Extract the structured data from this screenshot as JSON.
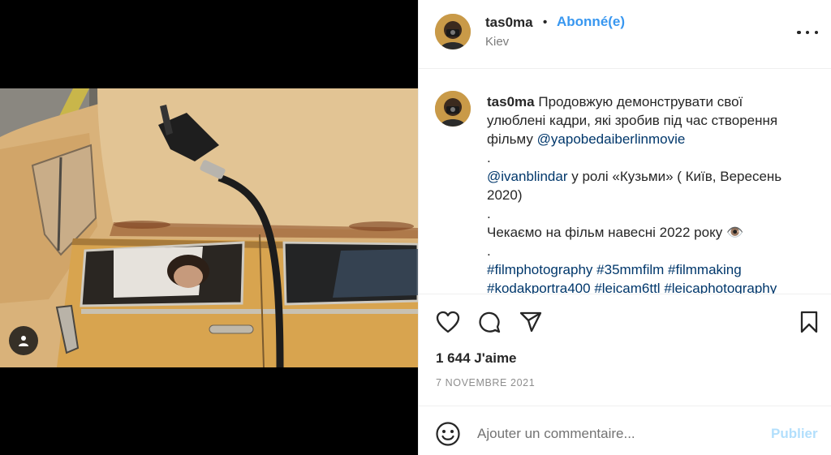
{
  "post": {
    "username": "tas0ma",
    "separator": "•",
    "follow_label": "Abonné(e)",
    "location": "Kiev"
  },
  "caption": {
    "username": "tas0ma",
    "text_1": "Продовжую демонструвати свої",
    "text_2": "улюблені кадри, які зробив під час створення",
    "text_3": "фільму",
    "mention_1": "@yapobedaiberlinmovie",
    "dot_1": ".",
    "mention_2": "@ivanblindar",
    "text_4": "у ролі «Кузьми» ( Київ, Вересень",
    "text_5": "2020)",
    "dot_2": ".",
    "text_6": "Чекаємо на фільм навесні 2022 року",
    "emoji": "👁️",
    "dot_3": ".",
    "hashtags_line_1": [
      "#filmphotography",
      "#35mmfilm",
      "#filmmaking"
    ],
    "hashtags_line_2": [
      "#kodakportra400",
      "#leicam6ttl",
      "#leicaphotography"
    ]
  },
  "likes": "1 644 J'aime",
  "date": "7 NOVEMBRE 2021",
  "comment_box": {
    "placeholder": "Ajouter un commentaire...",
    "publish_label": "Publier"
  },
  "icons": {
    "like": "heart-icon",
    "comment": "comment-bubble-icon",
    "share": "paper-plane-icon",
    "save": "bookmark-icon",
    "tags": "user-tag-icon",
    "emoji": "smiley-icon",
    "more": "more-options-icon"
  },
  "colors": {
    "follow": "#3897f0",
    "link": "#00376b",
    "publish_disabled": "#b2dffc",
    "secondary_text": "#8e8e8e"
  }
}
